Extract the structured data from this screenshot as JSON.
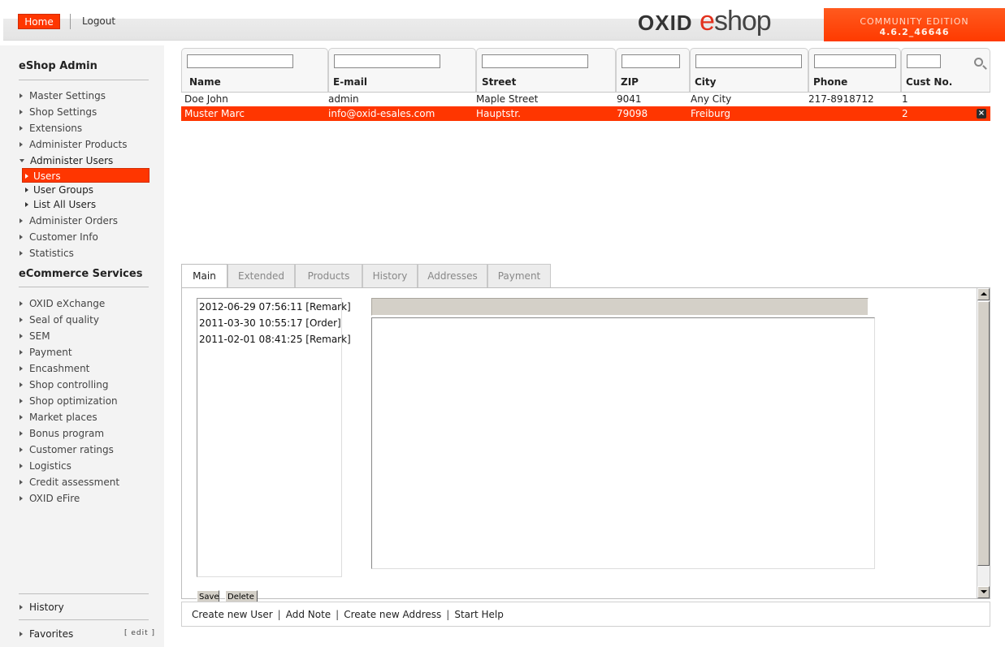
{
  "header": {
    "home_label": "Home",
    "logout_label": "Logout",
    "logo_oxid": "OXID",
    "logo_e": "e",
    "logo_shop": "shop",
    "edition_label": "COMMUNITY EDITION",
    "version": "4.6.2_46646",
    "accent_color": "#ff3600"
  },
  "sidebar": {
    "admin_title": "eShop Admin",
    "items": [
      {
        "label": "Master Settings"
      },
      {
        "label": "Shop Settings"
      },
      {
        "label": "Extensions"
      },
      {
        "label": "Administer Products"
      },
      {
        "label": "Administer Users",
        "expanded": true
      }
    ],
    "sub_items": [
      {
        "label": "Users",
        "active": true
      },
      {
        "label": "User Groups"
      },
      {
        "label": "List All Users"
      }
    ],
    "items_after": [
      {
        "label": "Administer Orders"
      },
      {
        "label": "Customer Info"
      },
      {
        "label": "Statistics"
      }
    ],
    "services_title": "eCommerce Services",
    "services": [
      {
        "label": "OXID eXchange"
      },
      {
        "label": "Seal of quality"
      },
      {
        "label": "SEM"
      },
      {
        "label": "Payment"
      },
      {
        "label": "Encashment"
      },
      {
        "label": "Shop controlling"
      },
      {
        "label": "Shop optimization"
      },
      {
        "label": "Market places"
      },
      {
        "label": "Bonus program"
      },
      {
        "label": "Customer ratings"
      },
      {
        "label": "Logistics"
      },
      {
        "label": "Credit assessment"
      },
      {
        "label": "OXID eFire"
      }
    ],
    "history_label": "History",
    "favorites_label": "Favorites",
    "edit_label": "[ edit ]"
  },
  "user_list": {
    "columns": [
      "Name",
      "E-mail",
      "Street",
      "ZIP",
      "City",
      "Phone",
      "Cust No."
    ],
    "filters": [
      "",
      "",
      "",
      "",
      "",
      "",
      ""
    ],
    "rows": [
      {
        "name": "Doe John",
        "email": "admin",
        "street": "Maple Street",
        "zip": "9041",
        "city": "Any City",
        "phone": "217-8918712",
        "cust_no": "1",
        "selected": false
      },
      {
        "name": "Muster Marc",
        "email": "info@oxid-esales.com",
        "street": "Hauptstr.",
        "zip": "79098",
        "city": "Freiburg",
        "phone": "",
        "cust_no": "2",
        "selected": true
      }
    ]
  },
  "tabs": [
    {
      "label": "Main",
      "active": true
    },
    {
      "label": "Extended"
    },
    {
      "label": "Products"
    },
    {
      "label": "History"
    },
    {
      "label": "Addresses"
    },
    {
      "label": "Payment"
    }
  ],
  "history_panel": {
    "remarks": [
      "2012-06-29 07:56:11 [Remark]",
      "2011-03-30 10:55:17 [Order]",
      "2011-02-01 08:41:25 [Remark]"
    ],
    "remark_header_value": "",
    "remark_text_value": "",
    "save_label": "Save",
    "delete_label": "Delete"
  },
  "actions": {
    "create_user": "Create new User",
    "add_note": "Add Note",
    "create_address": "Create new Address",
    "start_help": "Start Help",
    "separator": "|"
  }
}
